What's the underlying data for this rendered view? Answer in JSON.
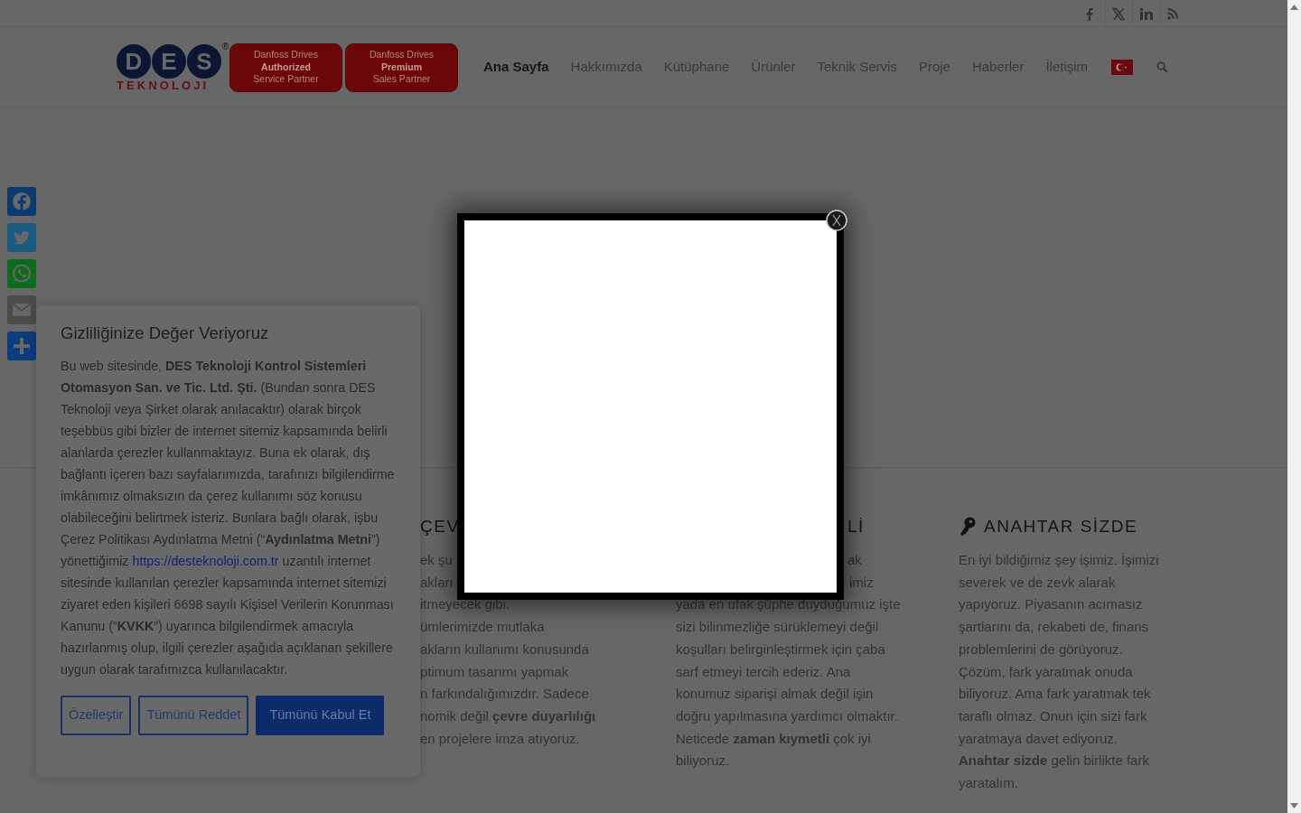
{
  "logo": {
    "letters": [
      "D",
      "E",
      "S"
    ],
    "wordmark": "TEKNOLOJI",
    "mark": "®"
  },
  "partner_badges": [
    {
      "lines": [
        {
          "text": "Danfoss Drives",
          "bold": false
        },
        {
          "text": "Authorized",
          "bold": true
        },
        {
          "text": "Service Partner",
          "bold": false
        }
      ]
    },
    {
      "lines": [
        {
          "text": "Danfoss Drives",
          "bold": false
        },
        {
          "text": "Premium",
          "bold": true
        },
        {
          "text": "Sales Partner",
          "bold": false
        }
      ]
    }
  ],
  "nav": {
    "items": [
      {
        "label": "Ana Sayfa",
        "selected": true
      },
      {
        "label": "Hakkımızda",
        "selected": false
      },
      {
        "label": "Kütüphane",
        "selected": false
      },
      {
        "label": "Ürünler",
        "selected": false
      },
      {
        "label": "Teknik Servis",
        "selected": false
      },
      {
        "label": "Proje",
        "selected": false
      },
      {
        "label": "Haberler",
        "selected": false
      },
      {
        "label": "İletişim",
        "selected": false
      }
    ]
  },
  "features": [
    {
      "kind": "cut",
      "heading": "ÇEV",
      "lines": [
        "ek şu",
        "akları",
        "itmeyecek gibi.",
        "ümlerimizde mutlaka",
        "akların kullanımı konusunda",
        "ptimum tasarımı yapmak",
        "n farkındalığımızdır. Sadece",
        "nomik değil **çevre duyarlılığı**",
        "en projelere imza atıyoruz."
      ]
    },
    {
      "kind": "partial",
      "heading": "Lİ",
      "fragments": [
        "ak",
        "imiz"
      ],
      "text": "yada en ufak şüphe duyduğumuz işte sizi bilinmezliğe sürüklemeyi değil koşulları belirginleştirmek için çaba sarf etmeyi tercih ederiz. Ana konumuz siparişi almak değil işin doğru yapılmasına yardımcı olmaktır. Neticede **zaman kıymetli** çok iyi biliyoruz."
    },
    {
      "kind": "full",
      "heading": "ANAHTAR SİZDE",
      "text": "En iyi bildiğimiz şey işimiz. İşimizi severek ve de zevk alarak yapıyoruz. Piyasanın acımasız şartlarını da, rekabeti de, finans problemlerini de görüyoruz. Çözüm, fark yaratmak onuda biliyoruz. Ama fark yaratmak tek taraflı olmaz. Onun için sizi fark yaratmaya davet ediyoruz. **Anahtar sizde** gelin birlikte fark yaratalım."
    }
  ],
  "cookie_banner": {
    "title": "Gizliliğinize Değer Veriyoruz",
    "parts": [
      {
        "kind": "text",
        "text": "Bu web sitesinde, **DES Teknoloji Kontrol Sistemleri Otomasyon San. ve Tic. Ltd. Şti.** (Bundan sonra DES Teknoloji veya Şirket olarak anılacaktır) olarak birçok teşebbüs gibi bizler de internet sitemiz kapsamında belirli alanlarda çerezler kullanmaktayız. Buna ek olarak, dış bağlantı içeren bazı sayfalarımızda, tarafınızı bilgilendirme imkânımız olmaksızın da çerez kullanımı söz konusu olabileceğini belirtmek isteriz. Bunlara bağlı olarak, işbu Çerez Politikası Aydınlatma Metni (“**Aydınlatma Metni**”) yönettiğimiz "
      },
      {
        "kind": "link",
        "text": "https://desteknoloji.com.tr"
      },
      {
        "kind": "text",
        "text": " uzantılı internet sitesinde kullanılan çerezler kapsamında internet sitemizi ziyaret eden kişileri 6698 sayılı Kişisel Verilerin Korunması Kanunu (“**KVKK**”) uyarınca bilgilendirmek amacıyla hazırlanmış olup, ilgili çerezler aşağıda açıklanan şekillere uygun olarak tarafımızca kullanılacaktır."
      }
    ],
    "buttons": [
      {
        "label": "Özelleştir",
        "kind": "outline"
      },
      {
        "label": "Tümünü Reddet",
        "kind": "outline"
      },
      {
        "label": "Tümünü Kabul Et",
        "kind": "primary"
      }
    ]
  }
}
